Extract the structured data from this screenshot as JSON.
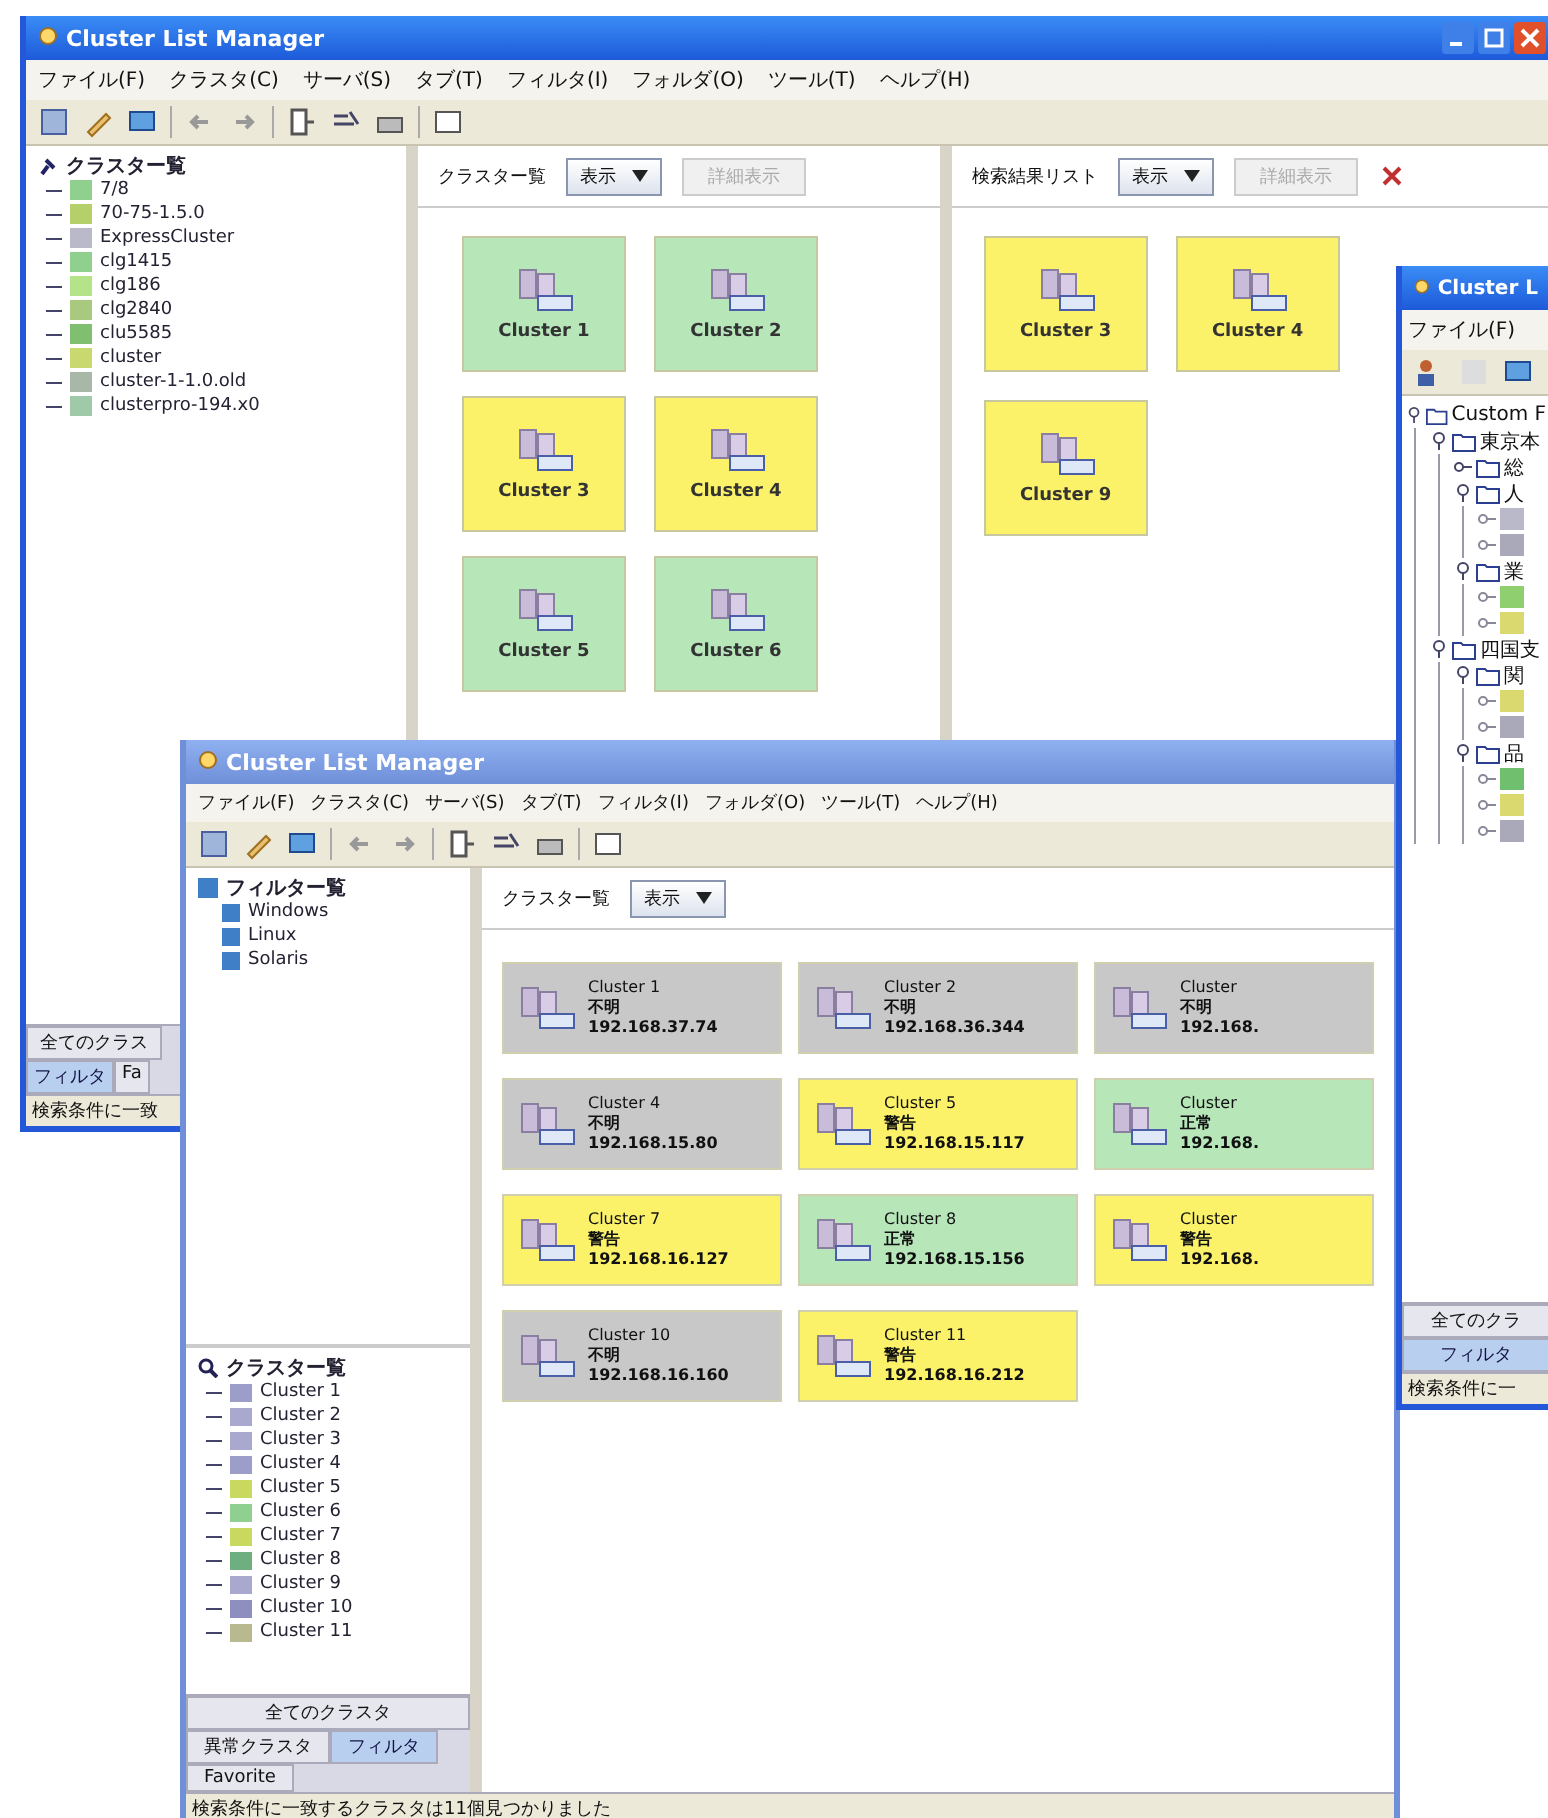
{
  "back_window": {
    "title": "Cluster List Manager",
    "menu": [
      "ファイル(F)",
      "クラスタ(C)",
      "サーバ(S)",
      "タブ(T)",
      "フィルタ(I)",
      "フォルダ(O)",
      "ツール(T)",
      "ヘルプ(H)"
    ],
    "tree": {
      "label": "クラスター覧",
      "items": [
        {
          "label": "7/8",
          "color": "#8fd08f"
        },
        {
          "label": "70-75-1.5.0",
          "color": "#b5cf6b"
        },
        {
          "label": "ExpressCluster",
          "color": "#b9b9c9"
        },
        {
          "label": "clg1415",
          "color": "#8fd08f"
        },
        {
          "label": "clg186",
          "color": "#b5e38a"
        },
        {
          "label": "clg2840",
          "color": "#a9c97f"
        },
        {
          "label": "clu5585",
          "color": "#7fbf6f"
        },
        {
          "label": "cluster",
          "color": "#c9d96f"
        },
        {
          "label": "cluster-1-1.0.old",
          "color": "#a8b8a8"
        },
        {
          "label": "clusterpro-194.x0",
          "color": "#9fc9a9"
        }
      ]
    },
    "left_tabs": [
      {
        "label": "全てのクラス",
        "selected": false
      },
      {
        "label": "フィルタ",
        "selected": true
      },
      {
        "label": "Fa",
        "selected": false
      }
    ],
    "status_bar": "検索条件に一致",
    "panels": [
      {
        "title": "クラスター覧",
        "view": "表示",
        "button": "詳細表示",
        "close_button": false,
        "cards": [
          {
            "name": "Cluster 1",
            "color": "#b7e6b9"
          },
          {
            "name": "Cluster 2",
            "color": "#b7e6b9"
          },
          {
            "name": "Cluster 3",
            "color": "#fbf26a"
          },
          {
            "name": "Cluster 4",
            "color": "#fbf26a"
          },
          {
            "name": "Cluster 5",
            "color": "#b7e6b9"
          },
          {
            "name": "Cluster 6",
            "color": "#b7e6b9"
          }
        ]
      },
      {
        "title": "検索結果リスト",
        "view": "表示",
        "button": "詳細表示",
        "close_button": true,
        "cards": [
          {
            "name": "Cluster 3",
            "color": "#fbf26a"
          },
          {
            "name": "Cluster 4",
            "color": "#fbf26a"
          },
          {
            "name": "Cluster 9",
            "color": "#fbf26a"
          }
        ]
      }
    ]
  },
  "front_window": {
    "title": "Cluster List Manager",
    "menu": [
      "ファイル(F)",
      "クラスタ(C)",
      "サーバ(S)",
      "タブ(T)",
      "フィルタ(I)",
      "フォルダ(O)",
      "ツール(T)",
      "ヘルプ(H)"
    ],
    "filter_tree": {
      "label": "フィルター覧",
      "items": [
        "Windows",
        "Linux",
        "Solaris"
      ]
    },
    "cluster_tree": {
      "label": "クラスター覧",
      "items": [
        {
          "label": "Cluster 1",
          "color": "#9d9dc9"
        },
        {
          "label": "Cluster 2",
          "color": "#a9a9cf"
        },
        {
          "label": "Cluster 3",
          "color": "#a9a9cf"
        },
        {
          "label": "Cluster 4",
          "color": "#9d9dc9"
        },
        {
          "label": "Cluster 5",
          "color": "#c9d95f"
        },
        {
          "label": "Cluster 6",
          "color": "#8fcf8f"
        },
        {
          "label": "Cluster 7",
          "color": "#c9d95f"
        },
        {
          "label": "Cluster 8",
          "color": "#6faf7f"
        },
        {
          "label": "Cluster 9",
          "color": "#a9a9cf"
        },
        {
          "label": "Cluster 10",
          "color": "#8f8fbf"
        },
        {
          "label": "Cluster 11",
          "color": "#b9b98f"
        }
      ]
    },
    "tab_rows": [
      [
        {
          "label": "全てのクラスタ",
          "selected": false
        }
      ],
      [
        {
          "label": "異常クラスタ",
          "selected": false
        },
        {
          "label": "フィルタ",
          "selected": true
        }
      ],
      [
        {
          "label": "Favorite",
          "selected": false
        }
      ]
    ],
    "panel": {
      "title": "クラスター覧",
      "view": "表示",
      "cards": [
        {
          "name": "Cluster 1",
          "state": "不明",
          "ip": "192.168.37.74",
          "color": "#c8c8c8"
        },
        {
          "name": "Cluster 2",
          "state": "不明",
          "ip": "192.168.36.344",
          "color": "#c8c8c8"
        },
        {
          "name": "Cluster",
          "state": "不明",
          "ip": "192.168.",
          "color": "#c8c8c8"
        },
        {
          "name": "Cluster 4",
          "state": "不明",
          "ip": "192.168.15.80",
          "color": "#c8c8c8"
        },
        {
          "name": "Cluster 5",
          "state": "警告",
          "ip": "192.168.15.117",
          "color": "#fbf26a"
        },
        {
          "name": "Cluster",
          "state": "正常",
          "ip": "192.168.",
          "color": "#b7e6b9"
        },
        {
          "name": "Cluster 7",
          "state": "警告",
          "ip": "192.168.16.127",
          "color": "#fbf26a"
        },
        {
          "name": "Cluster 8",
          "state": "正常",
          "ip": "192.168.15.156",
          "color": "#b7e6b9"
        },
        {
          "name": "Cluster",
          "state": "警告",
          "ip": "192.168.",
          "color": "#fbf26a"
        },
        {
          "name": "Cluster 10",
          "state": "不明",
          "ip": "192.168.16.160",
          "color": "#c8c8c8"
        },
        {
          "name": "Cluster 11",
          "state": "警告",
          "ip": "192.168.16.212",
          "color": "#fbf26a"
        }
      ]
    },
    "status_bar": "検索条件に一致するクラスタは11個見つかりました"
  },
  "side_window": {
    "title": "Cluster L",
    "menu": [
      "ファイル(F)"
    ],
    "tree": [
      {
        "label": "Custom F",
        "expanded": true,
        "children": [
          {
            "label": "東京本",
            "expanded": true,
            "children": [
              {
                "label": "総",
                "expanded": false
              },
              {
                "label": "人",
                "expanded": true,
                "children": [
                  {
                    "color": "#b9b9c9"
                  },
                  {
                    "color": "#a9a9b9"
                  }
                ]
              },
              {
                "label": "業",
                "expanded": true,
                "children": [
                  {
                    "color": "#8fcf6f"
                  },
                  {
                    "color": "#d9d96f"
                  }
                ]
              }
            ]
          },
          {
            "label": "四国支",
            "expanded": true,
            "children": [
              {
                "label": "関",
                "expanded": true,
                "children": [
                  {
                    "color": "#d9d96f"
                  },
                  {
                    "color": "#a9a9b9"
                  }
                ]
              },
              {
                "label": "品",
                "expanded": true,
                "children": [
                  {
                    "color": "#6fbf6f"
                  },
                  {
                    "color": "#d9d96f"
                  },
                  {
                    "color": "#a9a9b9"
                  }
                ]
              }
            ]
          }
        ]
      }
    ],
    "tabs": [
      {
        "label": "全てのクラ",
        "selected": false
      },
      {
        "label": "フィルタ",
        "selected": true
      }
    ],
    "status_bar": "検索条件に一"
  }
}
